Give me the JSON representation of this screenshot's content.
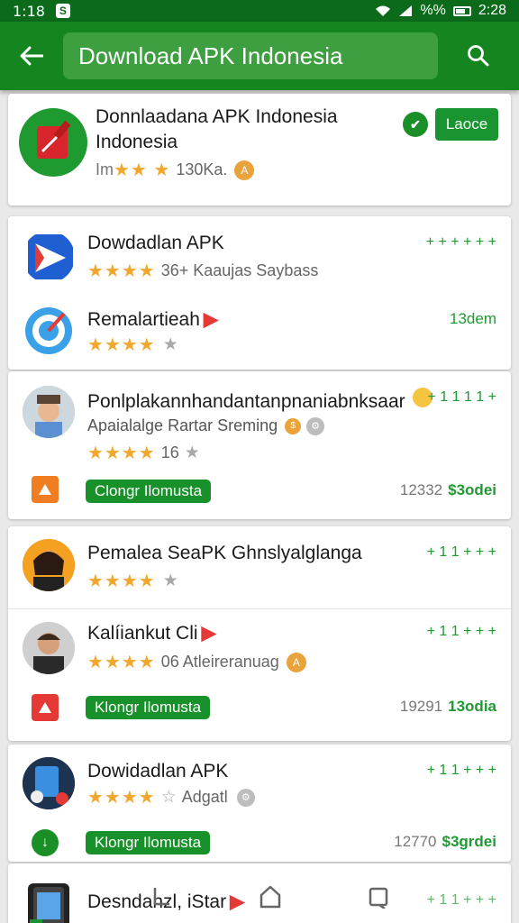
{
  "statusbar": {
    "time": "1:18",
    "battery": "%%",
    "time_right": "2:28"
  },
  "appbar": {
    "title": "Download APK Indonesia"
  },
  "featured": {
    "title_line1": "Donnlaadana APK Indonesia",
    "title_line2": "Indonesia",
    "rating_prefix": "Im",
    "meta": "130Ka.",
    "install_label": "Laoce",
    "verified_glyph": "✔"
  },
  "apps": [
    {
      "title": "Dowdadlan APK",
      "meta": "36+ Kaaujas Saybass",
      "tag": "+ + + + + +"
    },
    {
      "title": "Remalartieah",
      "tag": "13dem"
    },
    {
      "title": "Ponlplakannhandantanpnaniabnksaar",
      "subtitle": "Apaialalge Rartar Sreming",
      "meta": "16",
      "tag": "+ 1 1 1 1 +",
      "chip": "Clongr Ilomusta",
      "size_num": "12332",
      "size": "$3odei"
    },
    {
      "title": "Pemalea SeaPK Ghnslyalglanga",
      "tag": "+ 1 1 + + +"
    },
    {
      "title": "Kalíiankut Cli",
      "meta": "06 Atleireranuag",
      "tag": "+ 1 1 + + +",
      "chip": "Klongr Ilomusta",
      "size_num": "19291",
      "size": "13odia"
    },
    {
      "title": "Dowidadlan APK",
      "meta": "Adgatl",
      "tag": "+ 1 1 + + +",
      "chip": "Klongr Ilomusta",
      "size_num": "12770",
      "size": "$3grdei"
    },
    {
      "title": "Desndanzl, iStar",
      "tag": "+ 1 1 + + +"
    }
  ],
  "colors": {
    "primary": "#15861f",
    "statusbar": "#0c6a1b",
    "accent": "#1f9a31",
    "star": "#f2a72c"
  },
  "icons": [
    "back-arrow-icon",
    "search-icon",
    "star-icon",
    "back-nav-icon",
    "home-nav-icon",
    "recents-nav-icon"
  ]
}
